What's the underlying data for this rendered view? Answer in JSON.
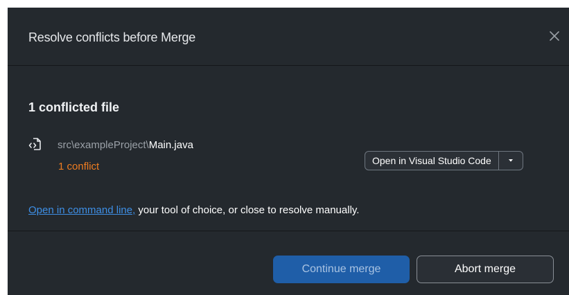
{
  "dialog": {
    "title": "Resolve conflicts before Merge",
    "close_icon": "close-icon"
  },
  "conflicts": {
    "heading": "1 conflicted file",
    "file": {
      "icon": "code-file-icon",
      "path_prefix": "src\\exampleProject\\",
      "file_name": "Main.java",
      "conflict_count": "1 conflict"
    },
    "open_button": {
      "label": "Open in Visual Studio Code",
      "dropdown_icon": "chevron-down-icon"
    },
    "help": {
      "link_text": "Open in command line,",
      "rest_text": " your tool of choice, or close to resolve manually."
    }
  },
  "footer": {
    "continue_label": "Continue merge",
    "abort_label": "Abort merge"
  },
  "colors": {
    "dialog_bg": "#24292e",
    "accent_link": "#3e8fe6",
    "conflict_orange": "#ef7d21",
    "primary_button": "#1f5ea8"
  }
}
